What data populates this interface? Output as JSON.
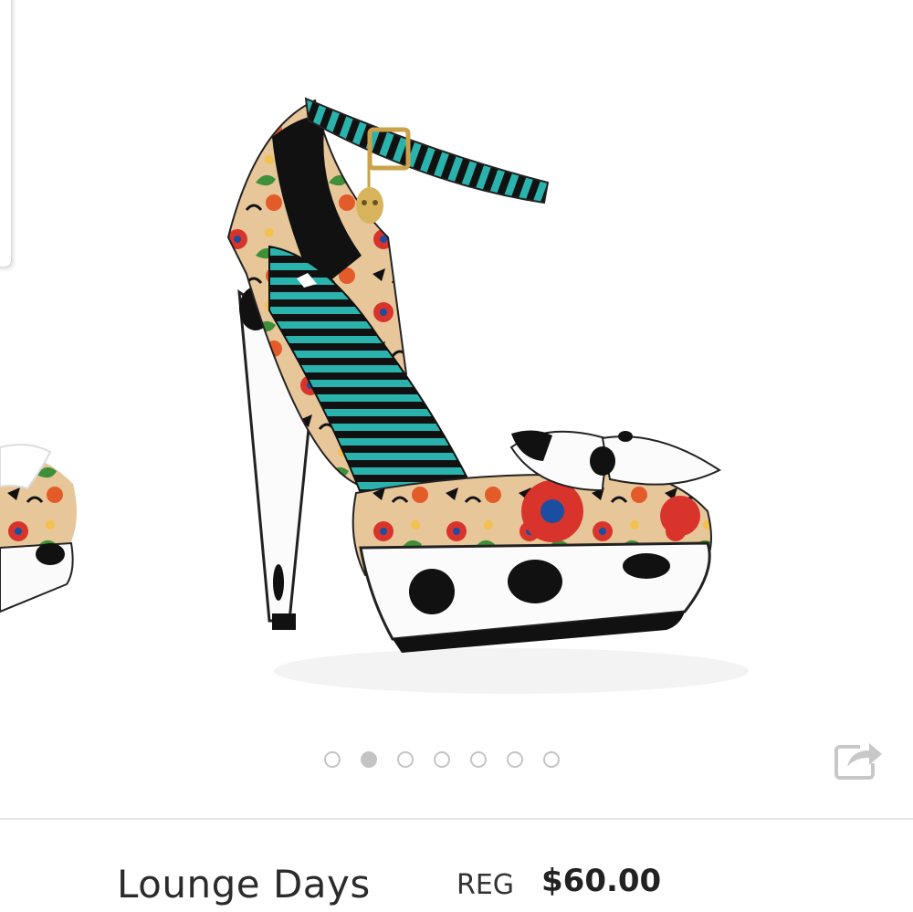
{
  "listing": {
    "title": "Lounge Days",
    "price_label": "REG",
    "price": "$60.00"
  },
  "gallery": {
    "image_count": 7,
    "active_index": 1,
    "share_icon": "share-arrow-icon"
  }
}
